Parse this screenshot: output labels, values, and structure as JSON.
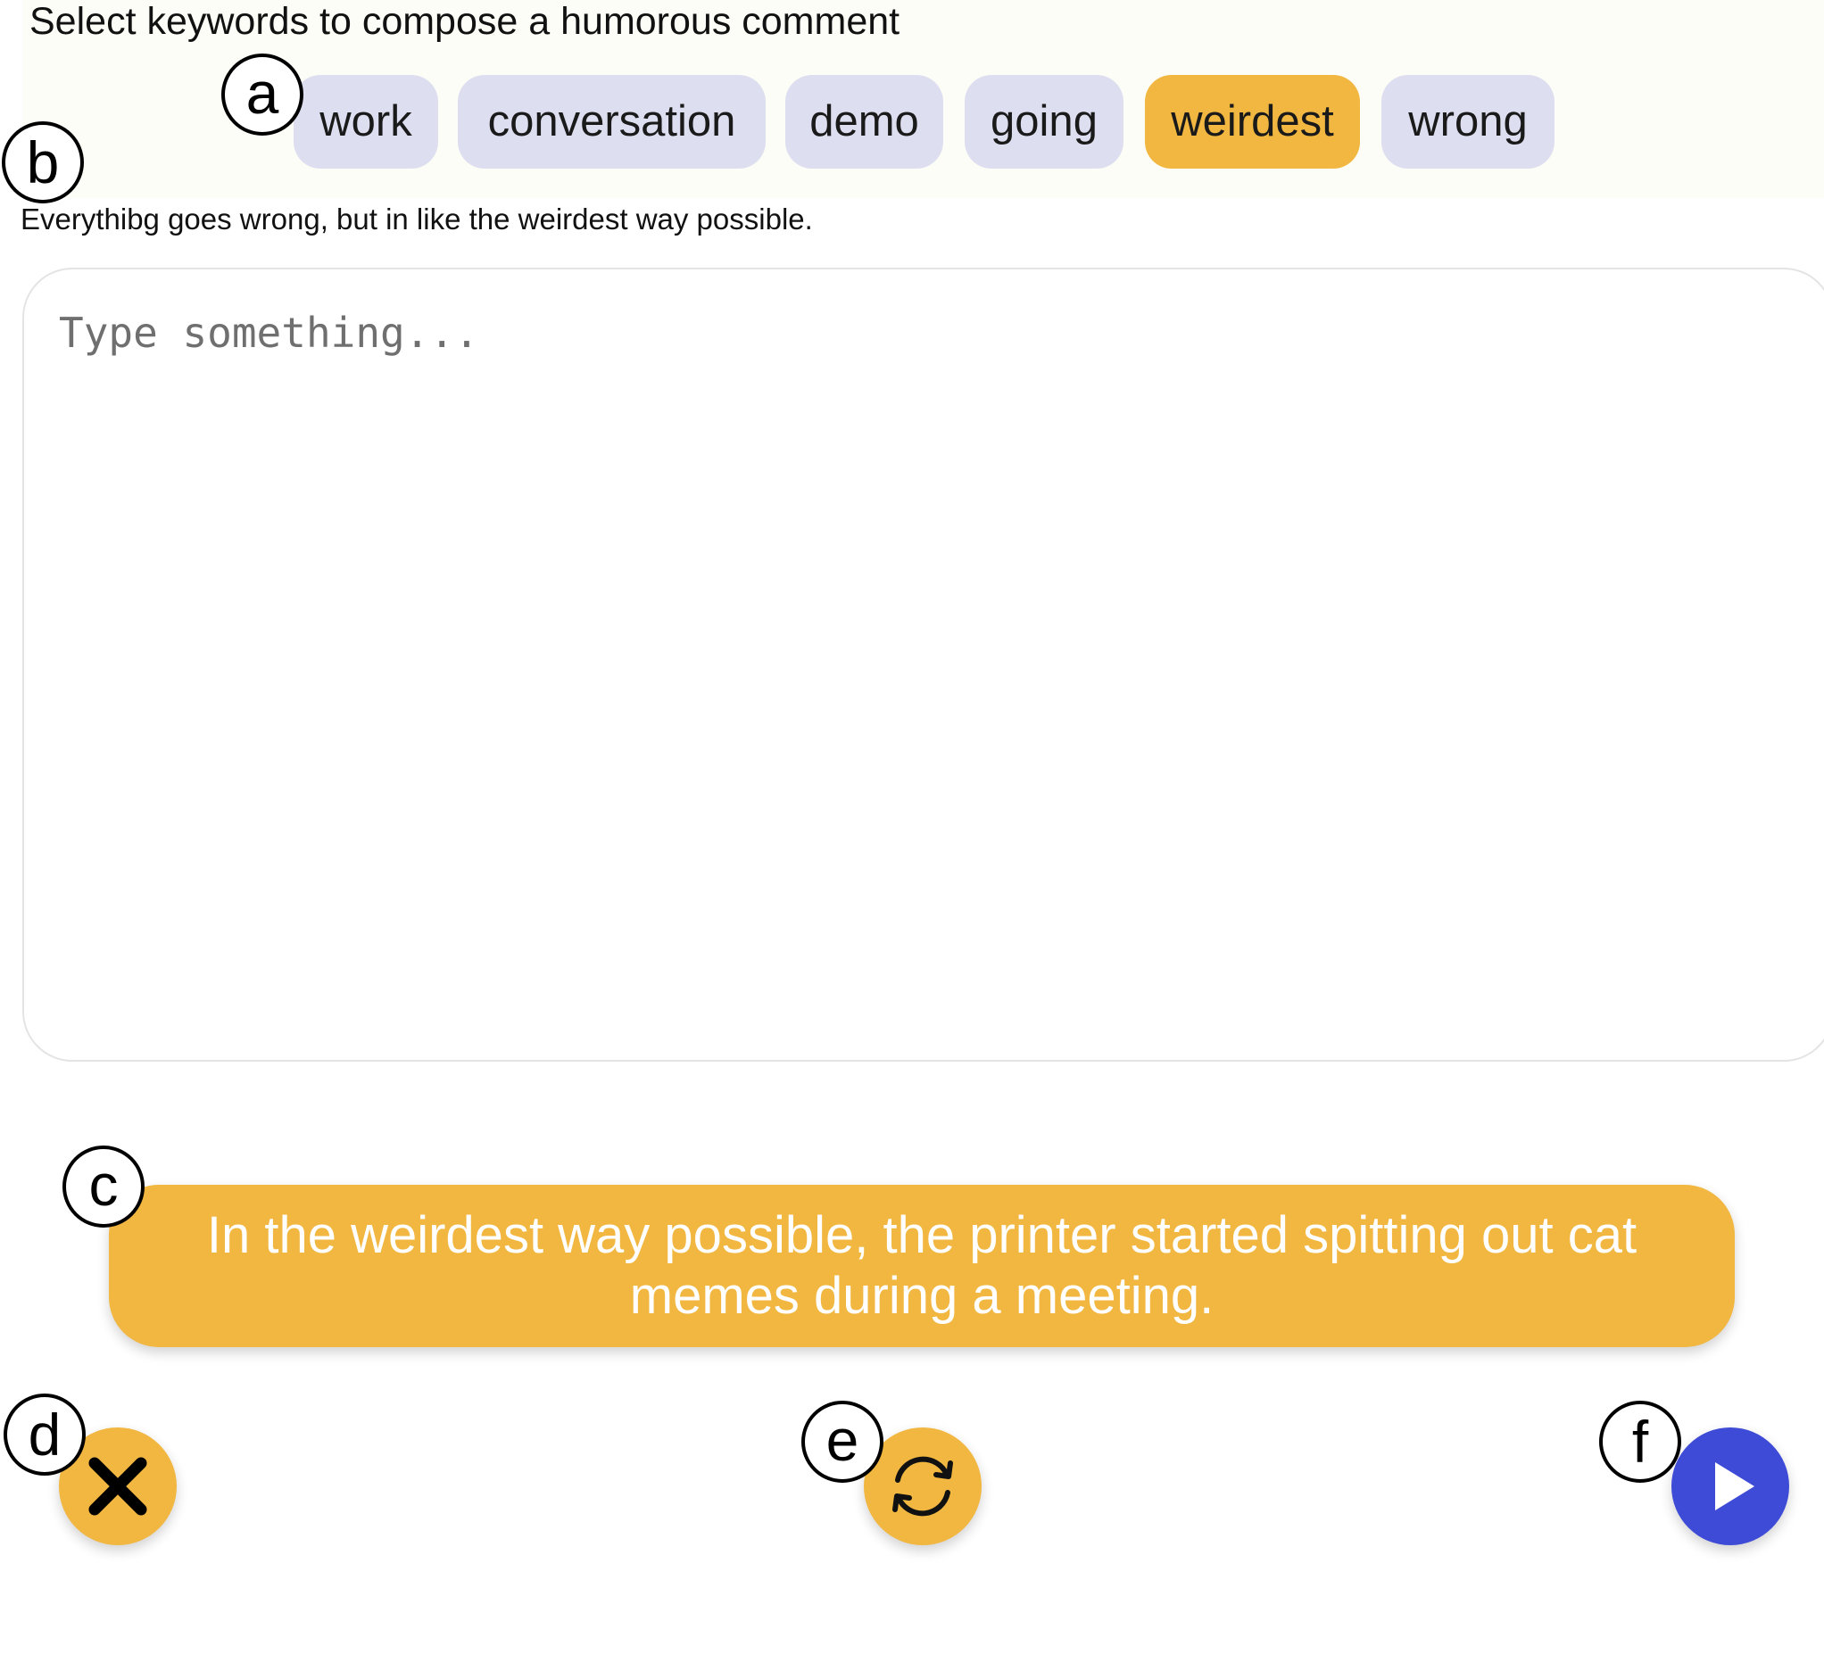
{
  "header": {
    "title": "Select keywords to compose a humorous comment"
  },
  "keywords": [
    {
      "label": "work",
      "selected": false
    },
    {
      "label": "conversation",
      "selected": false
    },
    {
      "label": "demo",
      "selected": false
    },
    {
      "label": "going",
      "selected": false
    },
    {
      "label": "weirdest",
      "selected": true
    },
    {
      "label": "wrong",
      "selected": false
    }
  ],
  "context": {
    "text": "Everythibg goes wrong, but in like the weirdest way possible."
  },
  "input": {
    "value": "",
    "placeholder": "Type something..."
  },
  "suggestion": {
    "text": "In the weirdest way possible, the printer started spitting out cat memes during a meeting."
  },
  "actions": {
    "dismiss_icon": "close-icon",
    "regenerate_icon": "refresh-icon",
    "send_icon": "play-icon"
  },
  "annotations": {
    "a": "a",
    "b": "b",
    "c": "c",
    "d": "d",
    "e": "e",
    "f": "f"
  },
  "colors": {
    "chip_default": "#dddff0",
    "chip_selected": "#f1b741",
    "accent_orange": "#f1b741",
    "accent_blue": "#3e4bd6"
  }
}
